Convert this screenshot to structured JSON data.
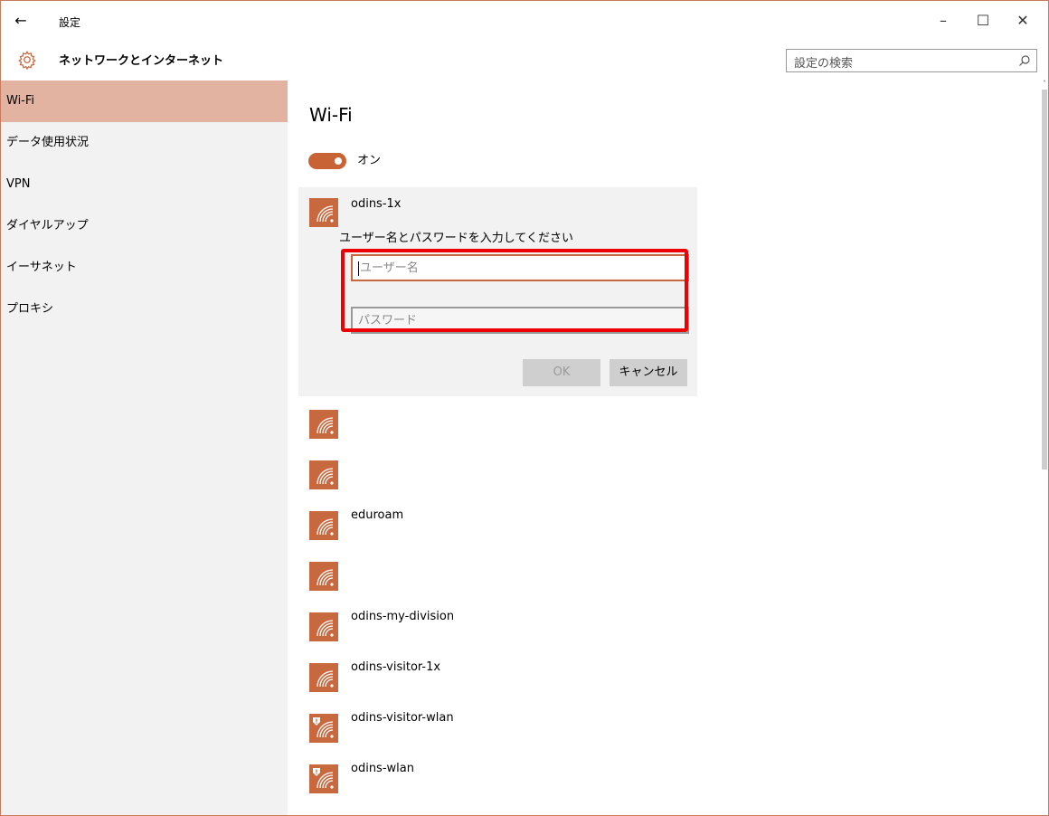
{
  "window": {
    "back_glyph": "←",
    "title": "設定",
    "minimize_glyph": "–",
    "maximize_glyph": "☐",
    "close_glyph": "✕"
  },
  "header": {
    "section_title": "ネットワークとインターネット",
    "search_placeholder": "設定の検索",
    "icons": {
      "settings": "gear-icon",
      "search": "search-icon"
    }
  },
  "sidebar": {
    "items": [
      {
        "label": "Wi-Fi",
        "active": true
      },
      {
        "label": "データ使用状況",
        "active": false
      },
      {
        "label": "VPN",
        "active": false
      },
      {
        "label": "ダイヤルアップ",
        "active": false
      },
      {
        "label": "イーサネット",
        "active": false
      },
      {
        "label": "プロキシ",
        "active": false
      }
    ]
  },
  "main": {
    "title": "Wi-Fi",
    "toggle": {
      "label": "オン",
      "on": true
    },
    "expanded_network": {
      "name": "odins-1x",
      "prompt": "ユーザー名とパスワードを入力してください",
      "username_placeholder": "ユーザー名",
      "password_placeholder": "パスワード",
      "ok_label": "OK",
      "cancel_label": "キャンセル"
    },
    "networks": [
      {
        "name": "",
        "secured": false
      },
      {
        "name": "",
        "secured": false
      },
      {
        "name": "eduroam",
        "secured": false
      },
      {
        "name": "",
        "secured": false
      },
      {
        "name": "odins-my-division",
        "secured": false
      },
      {
        "name": "odins-visitor-1x",
        "secured": false
      },
      {
        "name": "odins-visitor-wlan",
        "secured": true
      },
      {
        "name": "odins-wlan",
        "secured": true
      }
    ]
  },
  "colors": {
    "accent": "#c8683e",
    "nav_active": "#e3b3a1",
    "highlight_box": "#ee0000",
    "nav_bg": "#f2f2f2"
  }
}
